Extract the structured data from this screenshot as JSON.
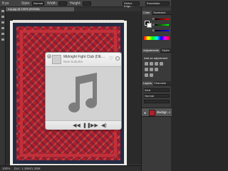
{
  "options_bar": {
    "menu_items": [
      "8 px",
      "Style:",
      "Normal",
      "Width:",
      "Height:",
      "Refine Edge..."
    ],
    "workspace": "Essentials"
  },
  "document": {
    "tab_label": "rug.jpg @ 100% (RGB/8)"
  },
  "status_bar": {
    "zoom": "100%",
    "doc_info": "Doc: 1.39M/1.39M"
  },
  "panels": {
    "color_tab": "Color",
    "swatches_tab": "Swatches",
    "slider_labels": [
      "R",
      "G",
      "B"
    ],
    "adjustments_tab": "Adjustments",
    "styles_tab": "Styles",
    "adjustments_title": "Add an adjustment",
    "layers_tab": "Layers",
    "channels_tab": "Channels",
    "layer_name": "Backgr...",
    "kind_label": "Kind",
    "normal_label": "Normal"
  },
  "player": {
    "track_title": "Midnight Fight Club (DEEUT TRRRE",
    "artist": "New Suburbs",
    "heart_icon": "heart-icon",
    "more_icon": "more-icon",
    "artwork_icon": "music-note-icon",
    "controls": [
      "rewind-icon",
      "pause-icon",
      "fast-forward-icon",
      "volume-icon"
    ]
  },
  "colors": {
    "accent": "#b41e2a",
    "panel_bg": "#3a3a3a",
    "player_bg": "#d4d4d4"
  }
}
